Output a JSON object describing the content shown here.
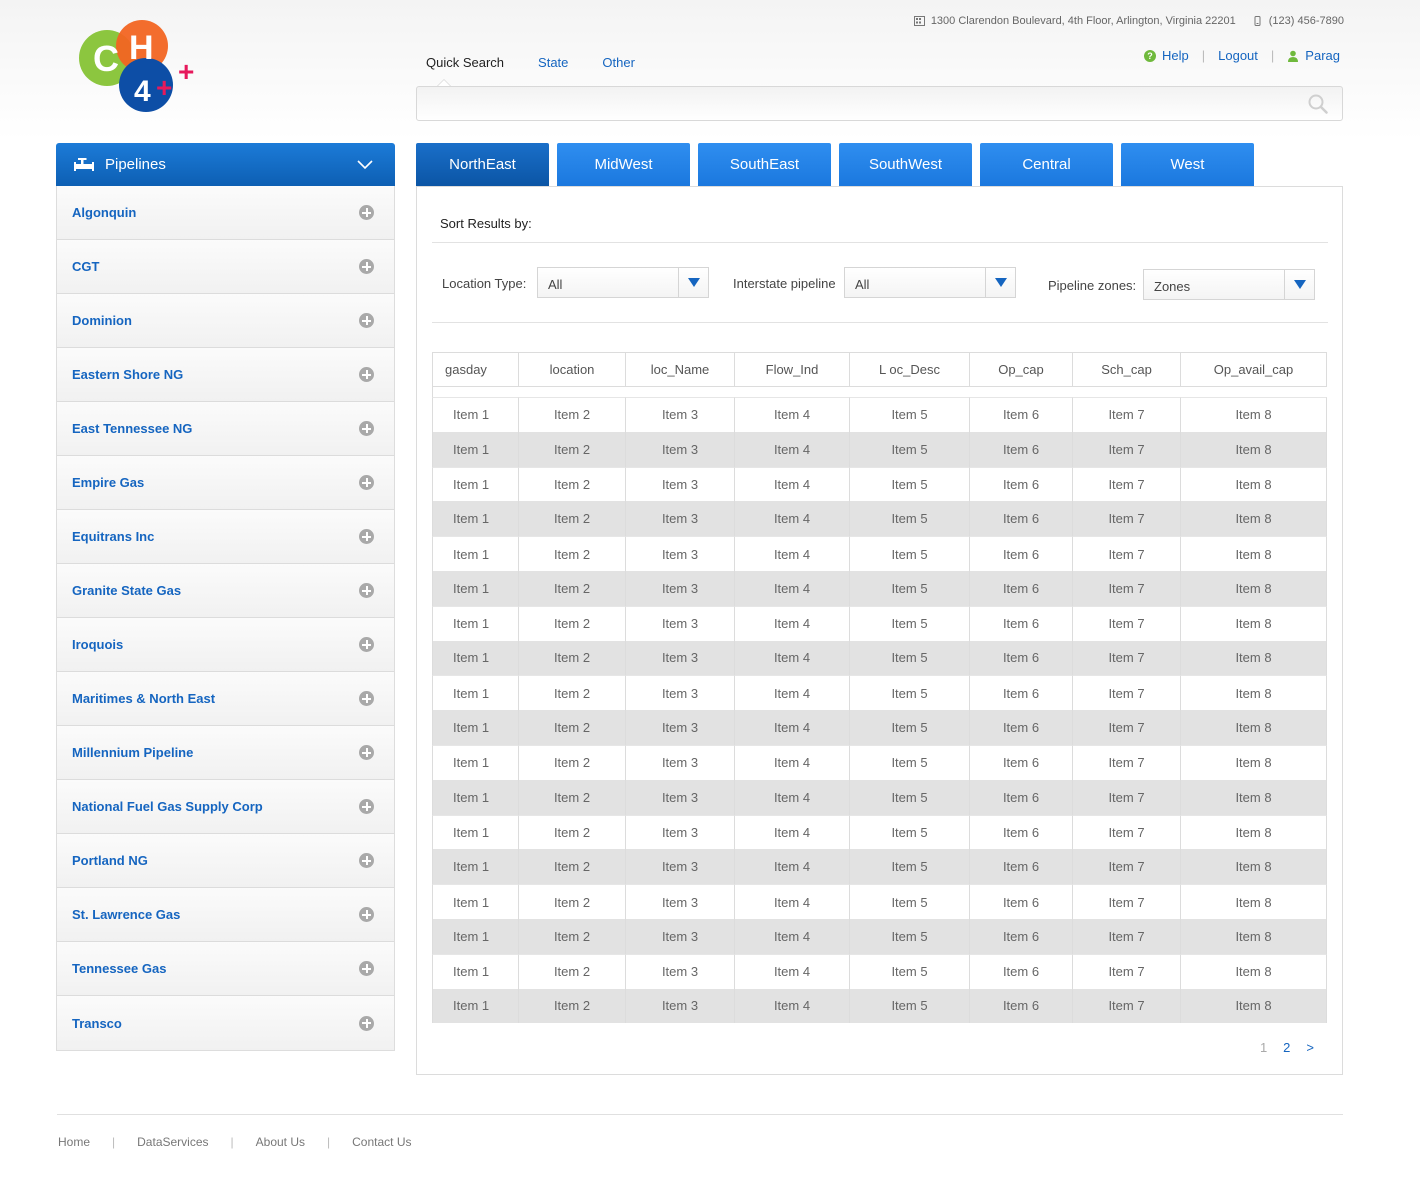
{
  "header": {
    "logo": {
      "c": "C",
      "h": "H",
      "four": "4",
      "plus": "+"
    },
    "address": "1300 Clarendon Boulevard, 4th Floor, Arlington, Virginia 22201",
    "phone": "(123) 456-7890",
    "help": "Help",
    "logout": "Logout",
    "user": "Parag"
  },
  "search": {
    "tabs": [
      "Quick Search",
      "State",
      "Other"
    ],
    "active_tab": "Quick Search",
    "placeholder": "",
    "value": ""
  },
  "sidebar": {
    "title": "Pipelines",
    "items": [
      "Algonquin",
      "CGT",
      "Dominion",
      "Eastern Shore NG",
      "East Tennessee NG",
      "Empire Gas",
      "Equitrans Inc",
      "Granite State Gas",
      "Iroquois",
      "Maritimes & North East",
      "Millennium Pipeline",
      "National Fuel Gas Supply Corp",
      "Portland NG",
      "St. Lawrence Gas",
      "Tennessee Gas",
      "Transco"
    ]
  },
  "regions": {
    "tabs": [
      "NorthEast",
      "MidWest",
      "SouthEast",
      "SouthWest",
      "Central",
      "West"
    ],
    "active": "NorthEast"
  },
  "filters": {
    "sort_title": "Sort Results by:",
    "location_type": {
      "label": "Location Type:",
      "value": "All"
    },
    "interstate": {
      "label": "Interstate pipeline",
      "value": "All"
    },
    "zones": {
      "label": "Pipeline zones:",
      "value": "Zones"
    }
  },
  "table": {
    "columns": [
      "gasday",
      "location",
      "loc_Name",
      "Flow_Ind",
      "L oc_Desc",
      "Op_cap",
      "Sch_cap",
      "Op_avail_cap"
    ],
    "rows": [
      [
        "Item 1",
        "Item 2",
        "Item 3",
        "Item 4",
        "Item 5",
        "Item 6",
        "Item 7",
        "Item 8"
      ],
      [
        "Item 1",
        "Item 2",
        "Item 3",
        "Item 4",
        "Item 5",
        "Item 6",
        "Item 7",
        "Item 8"
      ],
      [
        "Item 1",
        "Item 2",
        "Item 3",
        "Item 4",
        "Item 5",
        "Item 6",
        "Item 7",
        "Item 8"
      ],
      [
        "Item 1",
        "Item 2",
        "Item 3",
        "Item 4",
        "Item 5",
        "Item 6",
        "Item 7",
        "Item 8"
      ],
      [
        "Item 1",
        "Item 2",
        "Item 3",
        "Item 4",
        "Item 5",
        "Item 6",
        "Item 7",
        "Item 8"
      ],
      [
        "Item 1",
        "Item 2",
        "Item 3",
        "Item 4",
        "Item 5",
        "Item 6",
        "Item 7",
        "Item 8"
      ],
      [
        "Item 1",
        "Item 2",
        "Item 3",
        "Item 4",
        "Item 5",
        "Item 6",
        "Item 7",
        "Item 8"
      ],
      [
        "Item 1",
        "Item 2",
        "Item 3",
        "Item 4",
        "Item 5",
        "Item 6",
        "Item 7",
        "Item 8"
      ],
      [
        "Item 1",
        "Item 2",
        "Item 3",
        "Item 4",
        "Item 5",
        "Item 6",
        "Item 7",
        "Item 8"
      ],
      [
        "Item 1",
        "Item 2",
        "Item 3",
        "Item 4",
        "Item 5",
        "Item 6",
        "Item 7",
        "Item 8"
      ],
      [
        "Item 1",
        "Item 2",
        "Item 3",
        "Item 4",
        "Item 5",
        "Item 6",
        "Item 7",
        "Item 8"
      ],
      [
        "Item 1",
        "Item 2",
        "Item 3",
        "Item 4",
        "Item 5",
        "Item 6",
        "Item 7",
        "Item 8"
      ],
      [
        "Item 1",
        "Item 2",
        "Item 3",
        "Item 4",
        "Item 5",
        "Item 6",
        "Item 7",
        "Item 8"
      ],
      [
        "Item 1",
        "Item 2",
        "Item 3",
        "Item 4",
        "Item 5",
        "Item 6",
        "Item 7",
        "Item 8"
      ],
      [
        "Item 1",
        "Item 2",
        "Item 3",
        "Item 4",
        "Item 5",
        "Item 6",
        "Item 7",
        "Item 8"
      ],
      [
        "Item 1",
        "Item 2",
        "Item 3",
        "Item 4",
        "Item 5",
        "Item 6",
        "Item 7",
        "Item 8"
      ],
      [
        "Item 1",
        "Item 2",
        "Item 3",
        "Item 4",
        "Item 5",
        "Item 6",
        "Item 7",
        "Item 8"
      ],
      [
        "Item 1",
        "Item 2",
        "Item 3",
        "Item 4",
        "Item 5",
        "Item 6",
        "Item 7",
        "Item 8"
      ]
    ]
  },
  "pagination": {
    "current": "1",
    "pages": [
      "2"
    ],
    "next": ">"
  },
  "footer": {
    "links": [
      "Home",
      "DataServices",
      "About Us",
      "Contact Us"
    ]
  },
  "colors": {
    "brand_blue": "#1565c0",
    "tab_blue": "#2f8ef0",
    "logo_green": "#8cc63f",
    "logo_orange": "#f26522",
    "logo_navy": "#0d4ea6",
    "logo_pink": "#e6195c"
  },
  "icons": {
    "address": "building-icon",
    "phone": "phone-icon",
    "help": "help-icon",
    "user": "user-icon",
    "search": "search-icon",
    "sidebar_header": "pipe-icon",
    "sidebar_toggle": "chevron-down-icon",
    "sidebar_item": "plus-circle-icon",
    "select": "caret-down-icon"
  }
}
